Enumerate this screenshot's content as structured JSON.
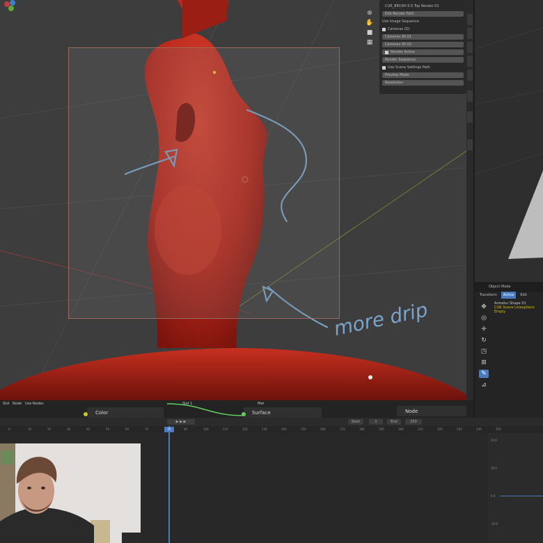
{
  "annotation": {
    "text": "more drip"
  },
  "npanel": {
    "rows": [
      {
        "text": "CUR_BRUSH 0:5 Top Render 01",
        "style": "dark"
      },
      {
        "text": "Edit Render Path",
        "style": "button"
      },
      {
        "text": "Use Image Sequence",
        "style": "label"
      },
      {
        "text": "Cameras (D)",
        "style": "label"
      },
      {
        "text": "Cameras 00.01",
        "style": "button"
      },
      {
        "text": "Cameras 00.02",
        "style": "button"
      },
      {
        "text": "Render Active",
        "style": "button"
      },
      {
        "text": "Render Sequence",
        "style": "button"
      },
      {
        "text": "Use Scene Settings Path",
        "style": "label"
      },
      {
        "text": "Preview Mode",
        "style": "button"
      },
      {
        "text": "Resolution",
        "style": "button"
      }
    ]
  },
  "right_properties": {
    "header": "Object Mode",
    "tabs": [
      "Transform",
      "Active",
      "Edit"
    ],
    "object_name": "Armatur Shape 01",
    "subtitle": "CUR Scene Lineoptions Empty"
  },
  "node_bar": {
    "items": [
      "Slot",
      "Node",
      "Use Nodes"
    ],
    "slot_value": "Slot 1",
    "node_color": "Color",
    "node_surface": "Surface",
    "material": "Mat",
    "misc": "Node"
  },
  "timeline": {
    "fields": [
      "Start",
      "1",
      "End",
      "250"
    ],
    "current_frame": "25",
    "ticks": [
      "0",
      "10",
      "20",
      "30",
      "40",
      "50",
      "60",
      "70",
      "80",
      "90",
      "100",
      "110",
      "120",
      "130",
      "140",
      "150",
      "160",
      "170",
      "180",
      "190",
      "200",
      "210",
      "220",
      "230",
      "240",
      "250"
    ]
  },
  "graph_labels": [
    "20.0",
    "10.0",
    "0.0",
    "-10.0"
  ],
  "colors": {
    "viewport_bg": "#3d3d3d",
    "sculpt_red": "#b8261a",
    "annotation_blue": "#7aa4c8",
    "accent_blue": "#4a7ac0"
  },
  "icons": {
    "toolbar": [
      "grab-icon",
      "cursor-icon",
      "move-icon",
      "rotate-icon",
      "scale-icon",
      "transform-icon",
      "annotate-icon",
      "measure-icon"
    ],
    "viewport": [
      "zoom-icon",
      "pan-icon",
      "camera-icon",
      "perspective-icon"
    ]
  }
}
